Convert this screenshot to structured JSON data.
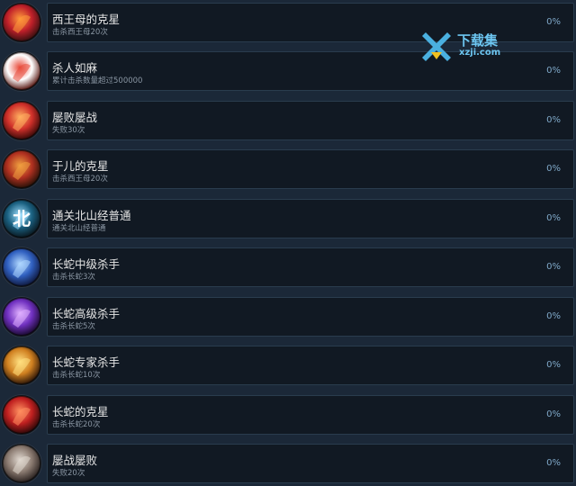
{
  "achievements": [
    {
      "title": "西王母的克星",
      "desc": "击杀西王母20次",
      "progress": "0%",
      "icon": "fire-demon-icon",
      "colors": [
        "#ff9a3a",
        "#c0202a",
        "#3a1010"
      ],
      "glyph": ""
    },
    {
      "title": "杀人如麻",
      "desc": "累计击杀数量超过500000",
      "progress": "0%",
      "icon": "blade-red-icon",
      "colors": [
        "#e84a3a",
        "#ffffff",
        "#5a1a14"
      ],
      "glyph": ""
    },
    {
      "title": "屡败屡战",
      "desc": "失败30次",
      "progress": "0%",
      "icon": "defeat-red-icon",
      "colors": [
        "#ffb060",
        "#d0302a",
        "#3a0a08"
      ],
      "glyph": ""
    },
    {
      "title": "于儿的克星",
      "desc": "击杀西王母20次",
      "progress": "0%",
      "icon": "demon-statue-icon",
      "colors": [
        "#f0a040",
        "#b03020",
        "#2a1208"
      ],
      "glyph": ""
    },
    {
      "title": "通关北山经普通",
      "desc": "通关北山经普通",
      "progress": "0%",
      "icon": "north-seal-icon",
      "colors": [
        "#a0e0ff",
        "#1a6080",
        "#0a1820"
      ],
      "glyph": "北"
    },
    {
      "title": "长蛇中级杀手",
      "desc": "击杀长蛇3次",
      "progress": "0%",
      "icon": "serpent-blue-icon",
      "colors": [
        "#b0d8ff",
        "#3060c0",
        "#101a40"
      ],
      "glyph": ""
    },
    {
      "title": "长蛇高级杀手",
      "desc": "击杀长蛇5次",
      "progress": "0%",
      "icon": "serpent-purple-icon",
      "colors": [
        "#e0b0ff",
        "#7030c0",
        "#1a0a30"
      ],
      "glyph": ""
    },
    {
      "title": "长蛇专家杀手",
      "desc": "击杀长蛇10次",
      "progress": "0%",
      "icon": "serpent-gold-icon",
      "colors": [
        "#ffe080",
        "#d08020",
        "#301808"
      ],
      "glyph": ""
    },
    {
      "title": "长蛇的克星",
      "desc": "击杀长蛇20次",
      "progress": "0%",
      "icon": "serpent-red-icon",
      "colors": [
        "#ff9060",
        "#c02020",
        "#300808"
      ],
      "glyph": ""
    },
    {
      "title": "屡战屡败",
      "desc": "失败20次",
      "progress": "0%",
      "icon": "defeat-grey-icon",
      "colors": [
        "#e0d8d0",
        "#8a7a70",
        "#2a2220"
      ],
      "glyph": ""
    }
  ],
  "watermark": {
    "title": "下载集",
    "subtitle": "xzji.com",
    "icon": "download-arrow-logo",
    "color": "#4ab0e0"
  }
}
